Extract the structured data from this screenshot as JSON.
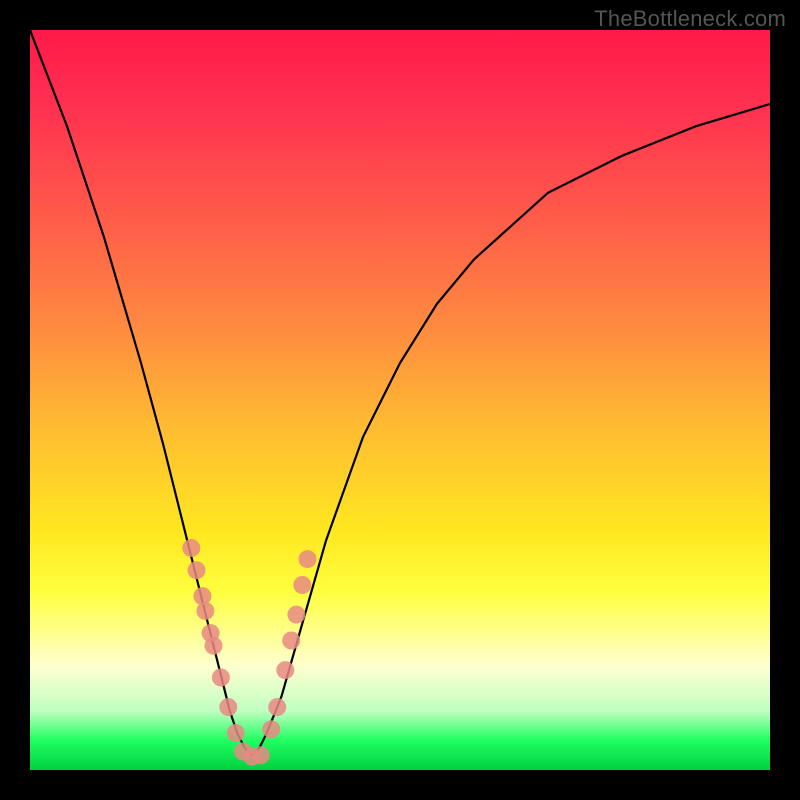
{
  "watermark": "TheBottleneck.com",
  "chart_data": {
    "type": "line",
    "title": "",
    "xlabel": "",
    "ylabel": "",
    "xlim": [
      0,
      1
    ],
    "ylim": [
      0,
      1
    ],
    "series": [
      {
        "name": "bottleneck-curve",
        "x": [
          0.0,
          0.05,
          0.1,
          0.15,
          0.18,
          0.2,
          0.22,
          0.24,
          0.26,
          0.27,
          0.28,
          0.29,
          0.3,
          0.31,
          0.32,
          0.34,
          0.36,
          0.38,
          0.4,
          0.45,
          0.5,
          0.55,
          0.6,
          0.7,
          0.8,
          0.9,
          1.0
        ],
        "y": [
          1.0,
          0.87,
          0.72,
          0.55,
          0.44,
          0.36,
          0.28,
          0.2,
          0.12,
          0.08,
          0.05,
          0.03,
          0.02,
          0.03,
          0.05,
          0.1,
          0.17,
          0.24,
          0.31,
          0.45,
          0.55,
          0.63,
          0.69,
          0.78,
          0.83,
          0.87,
          0.9
        ]
      }
    ],
    "markers": {
      "name": "highlight-points",
      "x": [
        0.218,
        0.225,
        0.233,
        0.237,
        0.244,
        0.248,
        0.258,
        0.268,
        0.278,
        0.288,
        0.3,
        0.312,
        0.326,
        0.334,
        0.345,
        0.353,
        0.36,
        0.368,
        0.375
      ],
      "y": [
        0.3,
        0.27,
        0.235,
        0.215,
        0.185,
        0.168,
        0.125,
        0.085,
        0.05,
        0.025,
        0.018,
        0.02,
        0.055,
        0.085,
        0.135,
        0.175,
        0.21,
        0.25,
        0.285
      ]
    },
    "gradient_axis": "y",
    "gradient_meaning": "bottleneck-severity (top=high red, bottom=low green)"
  }
}
